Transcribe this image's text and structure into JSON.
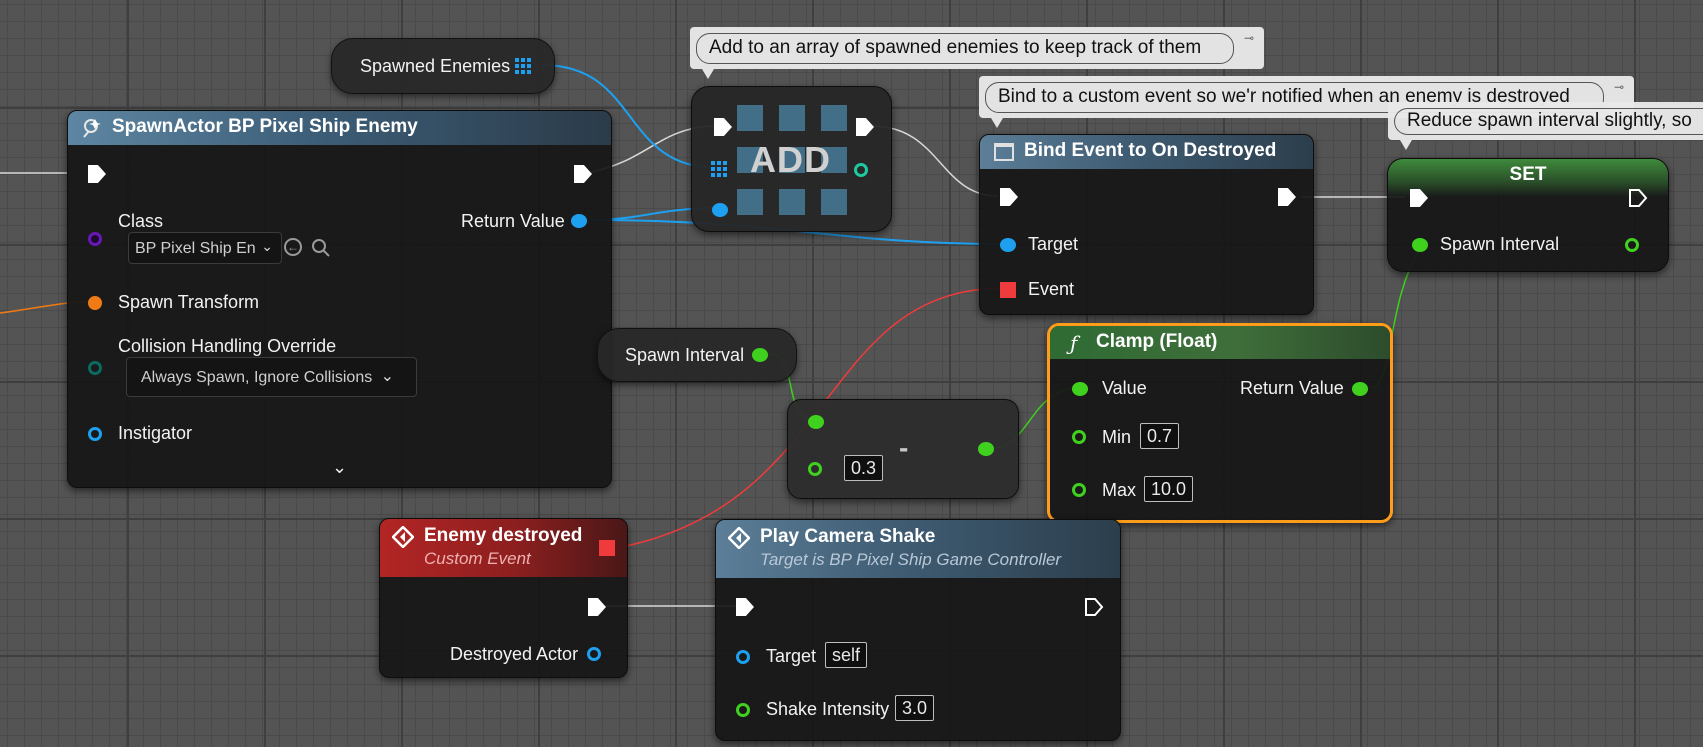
{
  "comments": {
    "array": "Add to an array of spawned enemies to keep track of them",
    "bind": "Bind to a custom event so we'r notified when an enemy is destroyed",
    "reduce": "Reduce spawn interval slightly, so"
  },
  "spawned_enemies": {
    "label": "Spawned Enemies"
  },
  "spawn_actor": {
    "title": "SpawnActor BP Pixel Ship Enemy",
    "class_label": "Class",
    "class_value": "BP Pixel Ship En",
    "return_value": "Return Value",
    "spawn_transform": "Spawn Transform",
    "collision_label": "Collision Handling Override",
    "collision_value": "Always Spawn, Ignore Collisions",
    "instigator": "Instigator"
  },
  "add_node": {
    "label": "ADD"
  },
  "bind_event": {
    "title": "Bind Event to On Destroyed",
    "target": "Target",
    "event": "Event"
  },
  "set_node": {
    "title": "SET",
    "spawn_interval": "Spawn Interval"
  },
  "spawn_interval_get": {
    "label": "Spawn Interval"
  },
  "subtract_node": {
    "operator": "-",
    "value": "0.3"
  },
  "clamp": {
    "title": "Clamp (Float)",
    "value_label": "Value",
    "return_value": "Return Value",
    "min_label": "Min",
    "min_value": "0.7",
    "max_label": "Max",
    "max_value": "10.0"
  },
  "enemy_destroyed": {
    "title": "Enemy destroyed",
    "subtitle": "Custom Event",
    "destroyed_actor": "Destroyed Actor"
  },
  "camera_shake": {
    "title": "Play Camera Shake",
    "subtitle": "Target is BP Pixel Ship Game Controller",
    "target_label": "Target",
    "target_value": "self",
    "intensity_label": "Shake Intensity",
    "intensity_value": "3.0"
  },
  "colors": {
    "object_pin": "#1ea0f0",
    "float_pin": "#3fd11e",
    "class_pin": "#6a17b8",
    "struct_pin": "#f07a14",
    "enum_pin": "#0b6b62",
    "delegate_pin": "#ef3b3b",
    "selected_outline": "#ff9d1a"
  }
}
